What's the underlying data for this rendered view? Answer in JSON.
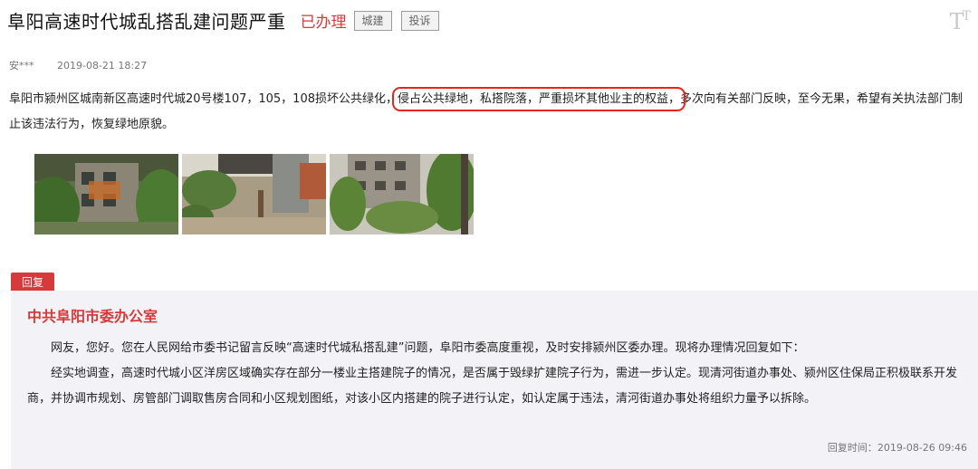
{
  "header": {
    "title": "阜阳高速时代城乱搭乱建问题严重",
    "status": "已办理",
    "tags": [
      "城建",
      "投诉"
    ],
    "font_toggle": "T"
  },
  "meta": {
    "user": "安***",
    "date": "2019-08-21 18:27"
  },
  "message": {
    "before": "阜阳市颍州区城南新区高速时代城20号楼107，105，108损坏公共绿化，",
    "highlight": "侵占公共绿地，私搭院落，严重损坏其他业主的权益，",
    "after": "多次向有关部门反映，至今无果，希望有关执法部门制止该违法行为，恢复绿地原貌。"
  },
  "reply": {
    "tab_label": "回复",
    "org": "中共阜阳市委办公室",
    "paragraphs": [
      "网友，您好。您在人民网给市委书记留言反映“高速时代城私搭乱建”问题，阜阳市委高度重视，及时安排颍州区委办理。现将办理情况回复如下：",
      "经实地调查，高速时代城小区洋房区域确实存在部分一楼业主搭建院子的情况，是否属于毁绿扩建院子行为，需进一步认定。现清河街道办事处、颍州区住保局正积极联系开发商，并协调市规划、房管部门调取售房合同和小区规划图纸，对该小区内搭建的院子进行认定，如认定属于违法，清河街道办事处将组织力量予以拆除。"
    ],
    "time": "回复时间：2019-08-26 09:46"
  }
}
